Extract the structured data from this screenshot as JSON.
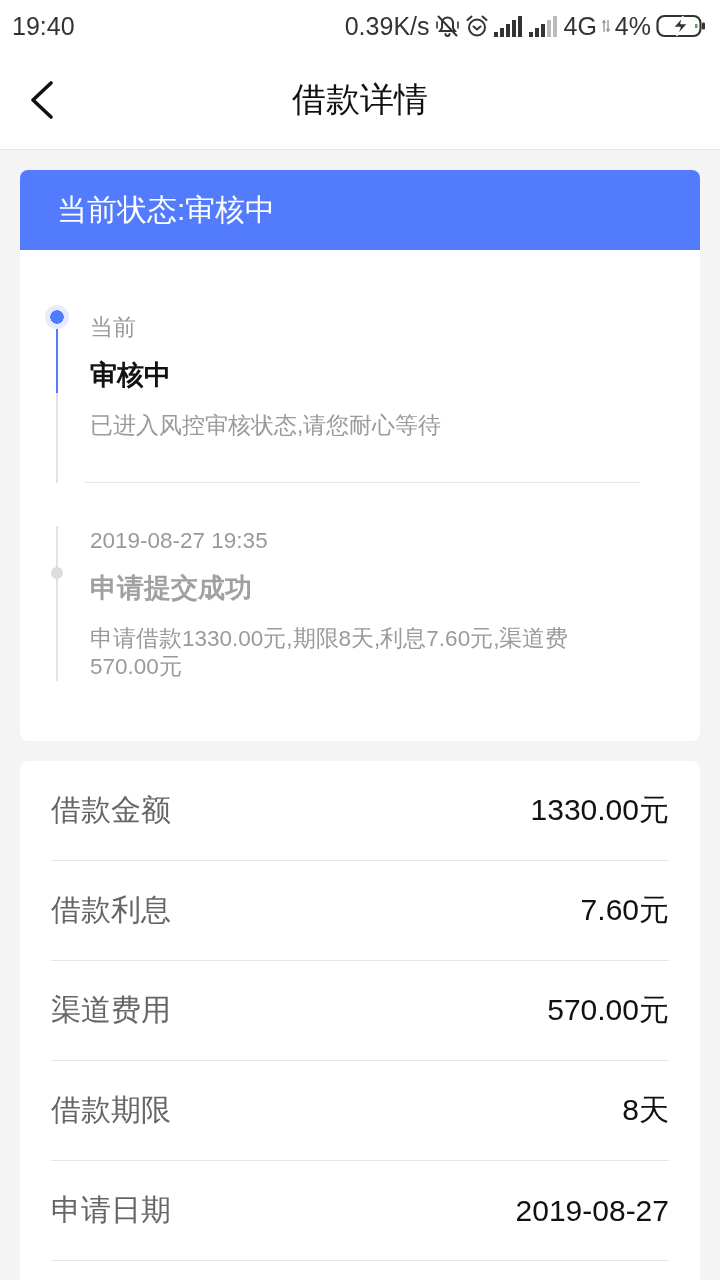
{
  "status_bar": {
    "time": "19:40",
    "net_speed": "0.39K/s",
    "network_type": "4G",
    "battery": "4%"
  },
  "nav": {
    "title": "借款详情"
  },
  "status_card": {
    "header": "当前状态:审核中",
    "timeline": [
      {
        "active": true,
        "time": "当前",
        "title": "审核中",
        "description": "已进入风控审核状态,请您耐心等待"
      },
      {
        "active": false,
        "time": "2019-08-27 19:35",
        "title": "申请提交成功",
        "description": "申请借款1330.00元,期限8天,利息7.60元,渠道费570.00元"
      }
    ]
  },
  "details": [
    {
      "label": "借款金额",
      "value": "1330.00元"
    },
    {
      "label": "借款利息",
      "value": "7.60元"
    },
    {
      "label": "渠道费用",
      "value": "570.00元"
    },
    {
      "label": "借款期限",
      "value": "8天"
    },
    {
      "label": "申请日期",
      "value": "2019-08-27"
    }
  ]
}
